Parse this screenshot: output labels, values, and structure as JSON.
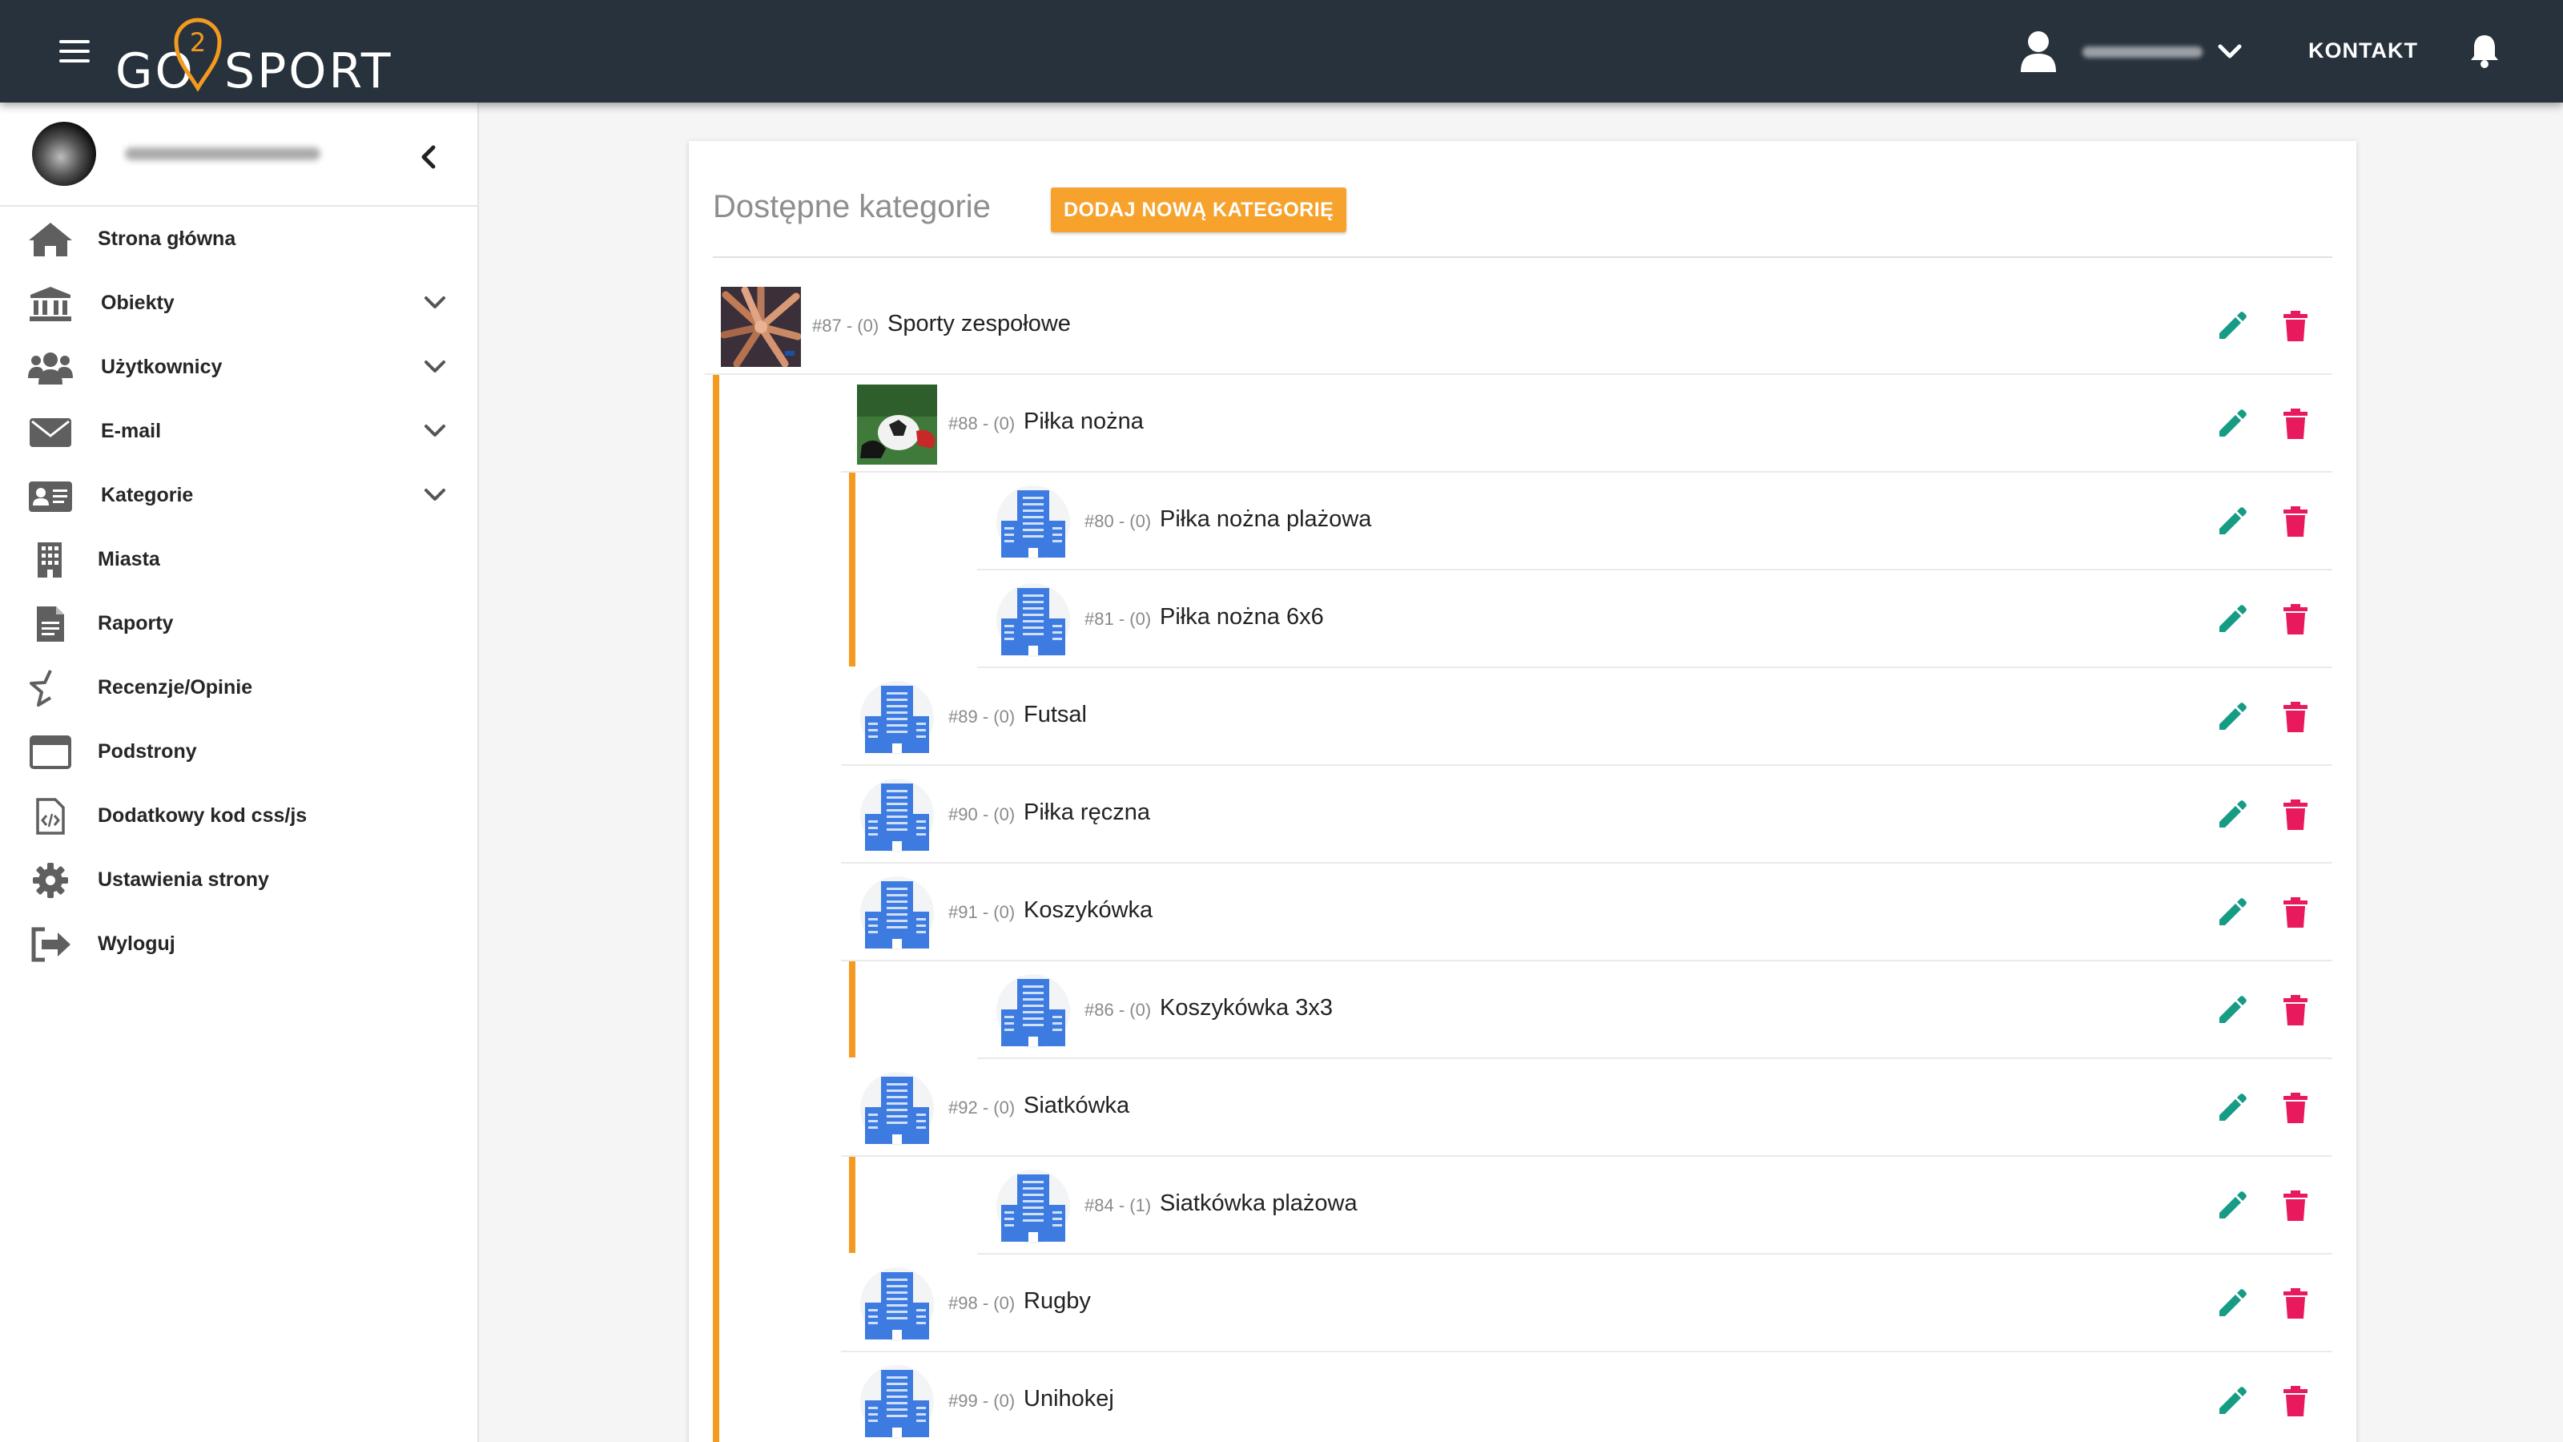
{
  "brand": {
    "logo_text_left": "GO",
    "logo_number": "2",
    "logo_text_right": "SPORT",
    "accent": "#f39a1f",
    "topbar_color": "#28323c"
  },
  "header": {
    "kontakt_label": "KONTAKT"
  },
  "sidebar": {
    "items": [
      {
        "label": "Strona główna",
        "icon": "home-icon",
        "expandable": false
      },
      {
        "label": "Obiekty",
        "icon": "bank-icon",
        "expandable": true
      },
      {
        "label": "Użytkownicy",
        "icon": "users-icon",
        "expandable": true
      },
      {
        "label": "E-mail",
        "icon": "envelope-icon",
        "expandable": true
      },
      {
        "label": "Kategorie",
        "icon": "id-card-icon",
        "expandable": true
      },
      {
        "label": "Miasta",
        "icon": "building-icon",
        "expandable": false
      },
      {
        "label": "Raporty",
        "icon": "document-icon",
        "expandable": false
      },
      {
        "label": "Recenzje/Opinie",
        "icon": "star-half-icon",
        "expandable": false
      },
      {
        "label": "Podstrony",
        "icon": "window-icon",
        "expandable": false
      },
      {
        "label": "Dodatkowy kod css/js",
        "icon": "code-file-icon",
        "expandable": false
      },
      {
        "label": "Ustawienia strony",
        "icon": "gear-icon",
        "expandable": false
      },
      {
        "label": "Wyloguj",
        "icon": "logout-icon",
        "expandable": false
      }
    ]
  },
  "main": {
    "title": "Dostępne kategorie",
    "add_button_label": "DODAJ NOWĄ KATEGORIĘ",
    "categories": [
      {
        "id": "#87 - (0)",
        "name": "Sporty zespołowe",
        "level": 0,
        "thumb": "photo-hands"
      },
      {
        "id": "#88 - (0)",
        "name": "Piłka nożna",
        "level": 1,
        "thumb": "photo-ball"
      },
      {
        "id": "#80 - (0)",
        "name": "Piłka nożna plażowa",
        "level": 2,
        "thumb": "building"
      },
      {
        "id": "#81 - (0)",
        "name": "Piłka nożna 6x6",
        "level": 2,
        "thumb": "building"
      },
      {
        "id": "#89 - (0)",
        "name": "Futsal",
        "level": 1,
        "thumb": "building"
      },
      {
        "id": "#90 - (0)",
        "name": "Piłka ręczna",
        "level": 1,
        "thumb": "building"
      },
      {
        "id": "#91 - (0)",
        "name": "Koszykówka",
        "level": 1,
        "thumb": "building"
      },
      {
        "id": "#86 - (0)",
        "name": "Koszykówka 3x3",
        "level": 2,
        "thumb": "building"
      },
      {
        "id": "#92 - (0)",
        "name": "Siatkówka",
        "level": 1,
        "thumb": "building"
      },
      {
        "id": "#84 - (1)",
        "name": "Siatkówka plażowa",
        "level": 2,
        "thumb": "building"
      },
      {
        "id": "#98 - (0)",
        "name": "Rugby",
        "level": 1,
        "thumb": "building"
      },
      {
        "id": "#99 - (0)",
        "name": "Unihokej",
        "level": 1,
        "thumb": "building"
      }
    ]
  }
}
